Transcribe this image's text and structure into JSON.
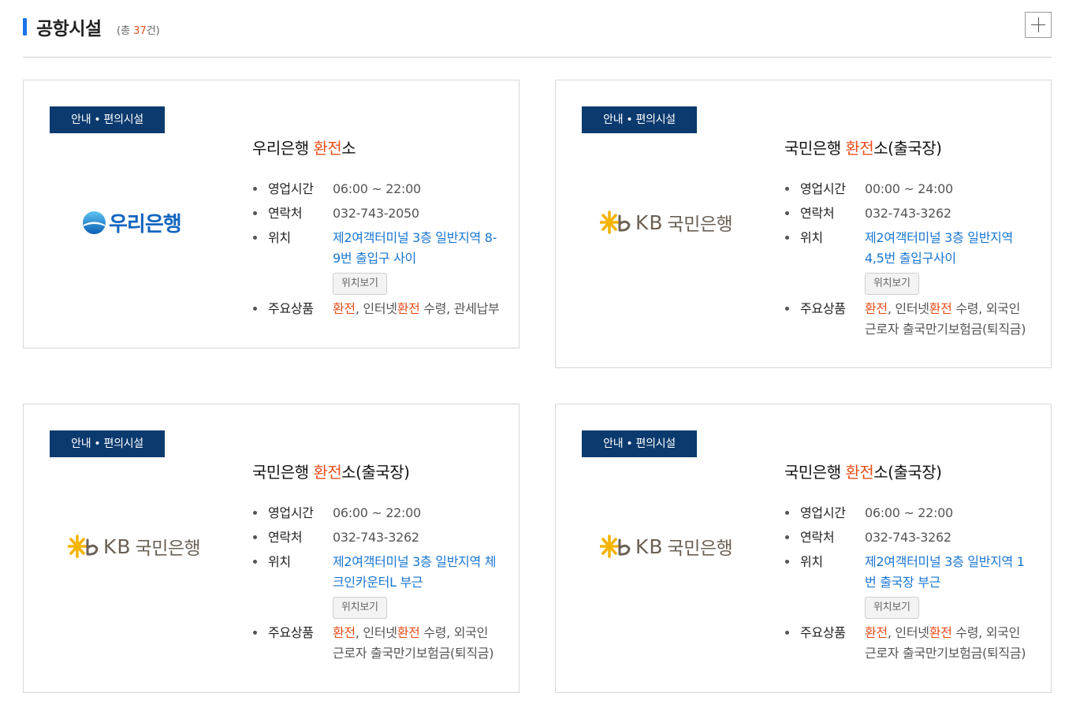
{
  "section": {
    "title": "공항시설",
    "count_prefix": "(총 ",
    "count": "37",
    "count_suffix": "건)"
  },
  "labels": {
    "hours": "영업시간",
    "contact": "연락처",
    "location": "위치",
    "products": "주요상품",
    "location_button": "위치보기"
  },
  "cards": [
    {
      "category": "안내 • 편의시설",
      "bank_logo": "우리은행",
      "title_pre": "우리은행 ",
      "title_hl": "환전",
      "title_post": "소",
      "hours": "06:00 ~ 22:00",
      "contact": "032-743-2050",
      "location": "제2여객터미널 3층 일반지역 8-9번 출입구 사이",
      "products": [
        {
          "text": "환전",
          "hl": true
        },
        {
          "text": ", 인터넷",
          "hl": false
        },
        {
          "text": "환전",
          "hl": true
        },
        {
          "text": " 수령, 관세납부",
          "hl": false
        }
      ]
    },
    {
      "category": "안내 • 편의시설",
      "bank_logo_latin": "KB",
      "bank_logo": "국민은행",
      "title_pre": "국민은행 ",
      "title_hl": "환전",
      "title_post": "소(출국장)",
      "hours": "00:00 ~ 24:00",
      "contact": "032-743-3262",
      "location": "제2여객터미널 3층 일반지역 4,5번 출입구사이",
      "products": [
        {
          "text": "환전",
          "hl": true
        },
        {
          "text": ", 인터넷",
          "hl": false
        },
        {
          "text": "환전",
          "hl": true
        },
        {
          "text": " 수령, 외국인 근로자 출국만기보험금(퇴직금)",
          "hl": false
        }
      ]
    },
    {
      "category": "안내 • 편의시설",
      "bank_logo_latin": "KB",
      "bank_logo": "국민은행",
      "title_pre": "국민은행 ",
      "title_hl": "환전",
      "title_post": "소(출국장)",
      "hours": "06:00 ~ 22:00",
      "contact": "032-743-3262",
      "location": "제2여객터미널 3층 일반지역 체크인카운터L 부근",
      "products": [
        {
          "text": "환전",
          "hl": true
        },
        {
          "text": ", 인터넷",
          "hl": false
        },
        {
          "text": "환전",
          "hl": true
        },
        {
          "text": " 수령, 외국인 근로자 출국만기보험금(퇴직금)",
          "hl": false
        }
      ]
    },
    {
      "category": "안내 • 편의시설",
      "bank_logo_latin": "KB",
      "bank_logo": "국민은행",
      "title_pre": "국민은행 ",
      "title_hl": "환전",
      "title_post": "소(출국장)",
      "hours": "06:00 ~ 22:00",
      "contact": "032-743-3262",
      "location": "제2여객터미널 3층 일반지역 1번 출국장 부근",
      "products": [
        {
          "text": "환전",
          "hl": true
        },
        {
          "text": ", 인터넷",
          "hl": false
        },
        {
          "text": "환전",
          "hl": true
        },
        {
          "text": " 수령, 외국인 근로자 출국만기보험금(퇴직금)",
          "hl": false
        }
      ]
    }
  ],
  "colors": {
    "accent": "#1a73e8",
    "badge": "#0b3a6e",
    "highlight": "#e8501c",
    "link": "#1976d2",
    "kb_gold": "#f4b400",
    "kb_gray": "#6b6055",
    "woori_blue": "#1565c0"
  }
}
